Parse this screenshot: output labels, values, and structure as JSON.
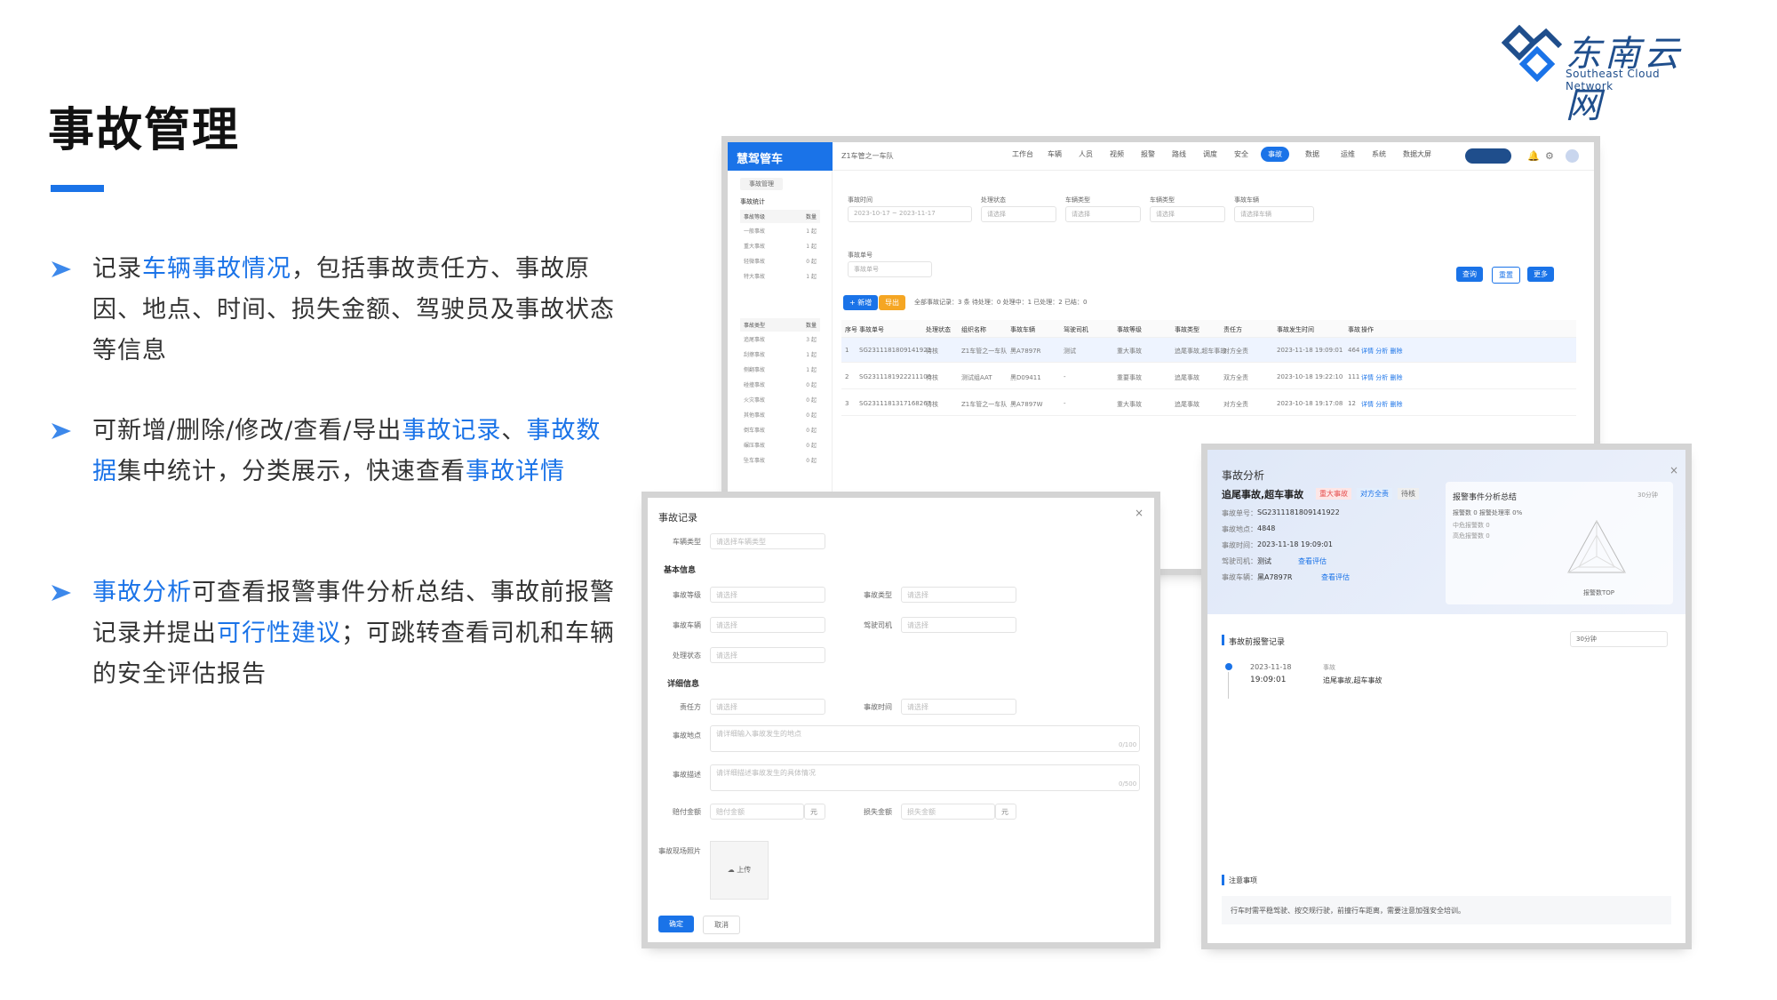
{
  "slide": {
    "title": "事故管理",
    "bullets": [
      {
        "parts": [
          {
            "t": "记录",
            "h": false
          },
          {
            "t": "车辆事故情况",
            "h": true
          },
          {
            "t": "，包括事故责任方、事故原因、地点、时间、损失金额、驾驶员及事故状态等信息",
            "h": false
          }
        ]
      },
      {
        "parts": [
          {
            "t": "可新增/删除/修改/查看/导出",
            "h": false
          },
          {
            "t": "事故记录",
            "h": true
          },
          {
            "t": "、",
            "h": false
          },
          {
            "t": "事故数据",
            "h": true
          },
          {
            "t": "集中统计，分类展示，快速查看",
            "h": false
          },
          {
            "t": "事故详情",
            "h": true
          }
        ]
      },
      {
        "parts": [
          {
            "t": "事故分析",
            "h": true
          },
          {
            "t": "可查看报警事件分析总结、事故前报警记录并提出",
            "h": false
          },
          {
            "t": "可行性建议",
            "h": true
          },
          {
            "t": "；可跳转查看司机和车辆的安全评估报告",
            "h": false
          }
        ]
      }
    ],
    "colors": {
      "accent": "#1a73e8",
      "arrow": "#1a73e8"
    }
  },
  "logo": {
    "cn": "东南云网",
    "en": "Southeast Cloud Network"
  },
  "app": {
    "logo_text": "慧驾管车",
    "company": "Z1车管之一车队",
    "nav": [
      "工作台",
      "车辆",
      "人员",
      "视频",
      "报警",
      "路线",
      "调度",
      "安全",
      "事故",
      "数据",
      "运维",
      "系统",
      "数据大屏"
    ],
    "nav_active": "事故",
    "tab": "事故管理",
    "side_group1": {
      "title": "事故统计",
      "header": [
        "事故等级",
        "数量"
      ],
      "rows": [
        [
          "一般事故",
          "1 起"
        ],
        [
          "重大事故",
          "1 起"
        ],
        [
          "轻微事故",
          "0 起"
        ],
        [
          "特大事故",
          "1 起"
        ]
      ]
    },
    "side_group2": {
      "header": [
        "事故类型",
        "数量"
      ],
      "rows": [
        [
          "追尾事故",
          "3 起"
        ],
        [
          "刮擦事故",
          "1 起"
        ],
        [
          "侧翻事故",
          "1 起"
        ],
        [
          "碰撞事故",
          "0 起"
        ],
        [
          "火灾事故",
          "0 起"
        ],
        [
          "其他事故",
          "0 起"
        ],
        [
          "倒车事故",
          "0 起"
        ],
        [
          "碾压事故",
          "0 起"
        ],
        [
          "坠车事故",
          "0 起"
        ]
      ]
    },
    "filters": [
      {
        "label": "事故时间",
        "value": "2023-10-17  ~  2023-11-17"
      },
      {
        "label": "处理状态",
        "value": "请选择"
      },
      {
        "label": "车辆类型",
        "value": "请选择"
      },
      {
        "label": "车辆类型",
        "value": "请选择"
      },
      {
        "label": "事故车辆",
        "value": "请选择车辆"
      }
    ],
    "search_label": "事故单号",
    "search_placeholder": "事故单号",
    "btn_search": "查询",
    "btn_reset": "重置",
    "btn_more": "更多",
    "btn_add": "+ 新增",
    "btn_export": "导出",
    "status_summary": "全部事故记录：3 条   待处理：0   处理中：1   已处理：2   已结：0",
    "columns": [
      "序号",
      "事故单号",
      "处理状态",
      "组织名称",
      "事故车辆",
      "驾驶司机",
      "事故等级",
      "事故类型",
      "责任方",
      "事故发生时间",
      "事故",
      "操作"
    ],
    "rows": [
      [
        "1",
        "SG2311181809141922",
        "待核",
        "Z1车管之一车队",
        "黑A7897R",
        "测试",
        "重大事故",
        "追尾事故,超车事故",
        "对方全责",
        "2023-11-18 19:09:01",
        "464",
        "详情 分析 删除"
      ],
      [
        "2",
        "SG2311181922211100",
        "待核",
        "测试组AAT",
        "黑D09411",
        "-",
        "重要事故",
        "追尾事故",
        "双方全责",
        "2023-10-18 19:22:10",
        "111",
        "详情 分析 删除"
      ],
      [
        "3",
        "SG2311181317168267",
        "待核",
        "Z1车管之一车队",
        "黑A7897W",
        "-",
        "重大事故",
        "追尾事故",
        "对方全责",
        "2023-10-18 19:17:08",
        "12",
        "详情 分析 删除"
      ]
    ]
  },
  "record": {
    "title": "事故记录",
    "car_type_label": "车辆类型",
    "car_type_value": "请选择车辆类型",
    "section_basic": "基本信息",
    "section_detail": "详细信息",
    "fields": [
      {
        "label": "事故等级",
        "value": "请选择"
      },
      {
        "label": "事故类型",
        "value": "请选择"
      },
      {
        "label": "事故车辆",
        "value": "请选择"
      },
      {
        "label": "驾驶司机",
        "value": "请选择"
      },
      {
        "label": "处理状态",
        "value": "请选择"
      },
      {
        "label": "责任方",
        "value": "请选择"
      },
      {
        "label": "事故时间",
        "value": "请选择"
      }
    ],
    "place_label": "事故地点",
    "place_value": "请详细输入事故发生的地点",
    "place_count": "0/100",
    "desc_label": "事故描述",
    "desc_value": "请详细描述事故发生的具体情况",
    "desc_count": "0/500",
    "comp_label": "赔付金额",
    "comp_value": "赔付金额",
    "loss_label": "损失金额",
    "loss_value": "损失金额",
    "yuan": "元",
    "photo_label": "事故现场照片",
    "upload": "上传",
    "ok": "确定",
    "cancel": "取消"
  },
  "analysis": {
    "title": "事故分析",
    "headline": "追尾事故,超车事故",
    "tags": [
      "重大事故",
      "对方全责",
      "待核"
    ],
    "info": [
      {
        "k": "事故单号：",
        "v": "SG2311181809141922"
      },
      {
        "k": "事故地点：",
        "v": "4848"
      },
      {
        "k": "事故时间：",
        "v": "2023-11-18 19:09:01"
      },
      {
        "k": "驾驶司机：",
        "v": "测试"
      },
      {
        "k": "事故车辆：",
        "v": "黑A7897R"
      }
    ],
    "link_driver": "查看评估",
    "link_car": "查看评估",
    "summary_title": "报警事件分析总结",
    "summary_range": "30分钟",
    "summary_lines": [
      "报警数 0    报警处理率 0%",
      "中危报警数 0",
      "高危报警数 0"
    ],
    "radar_label": "报警数TOP",
    "prealarm_title": "事故前报警记录",
    "prealarm_range": "30分钟",
    "timeline_date": "2023-11-18",
    "timeline_time": "19:09:01",
    "timeline_label": "事故",
    "timeline_value": "追尾事故,超车事故",
    "notes_title": "注意事项",
    "notes_text": "行车时需平稳驾驶、按交规行驶，前撞行车距离，需要注意加强安全培训。"
  }
}
